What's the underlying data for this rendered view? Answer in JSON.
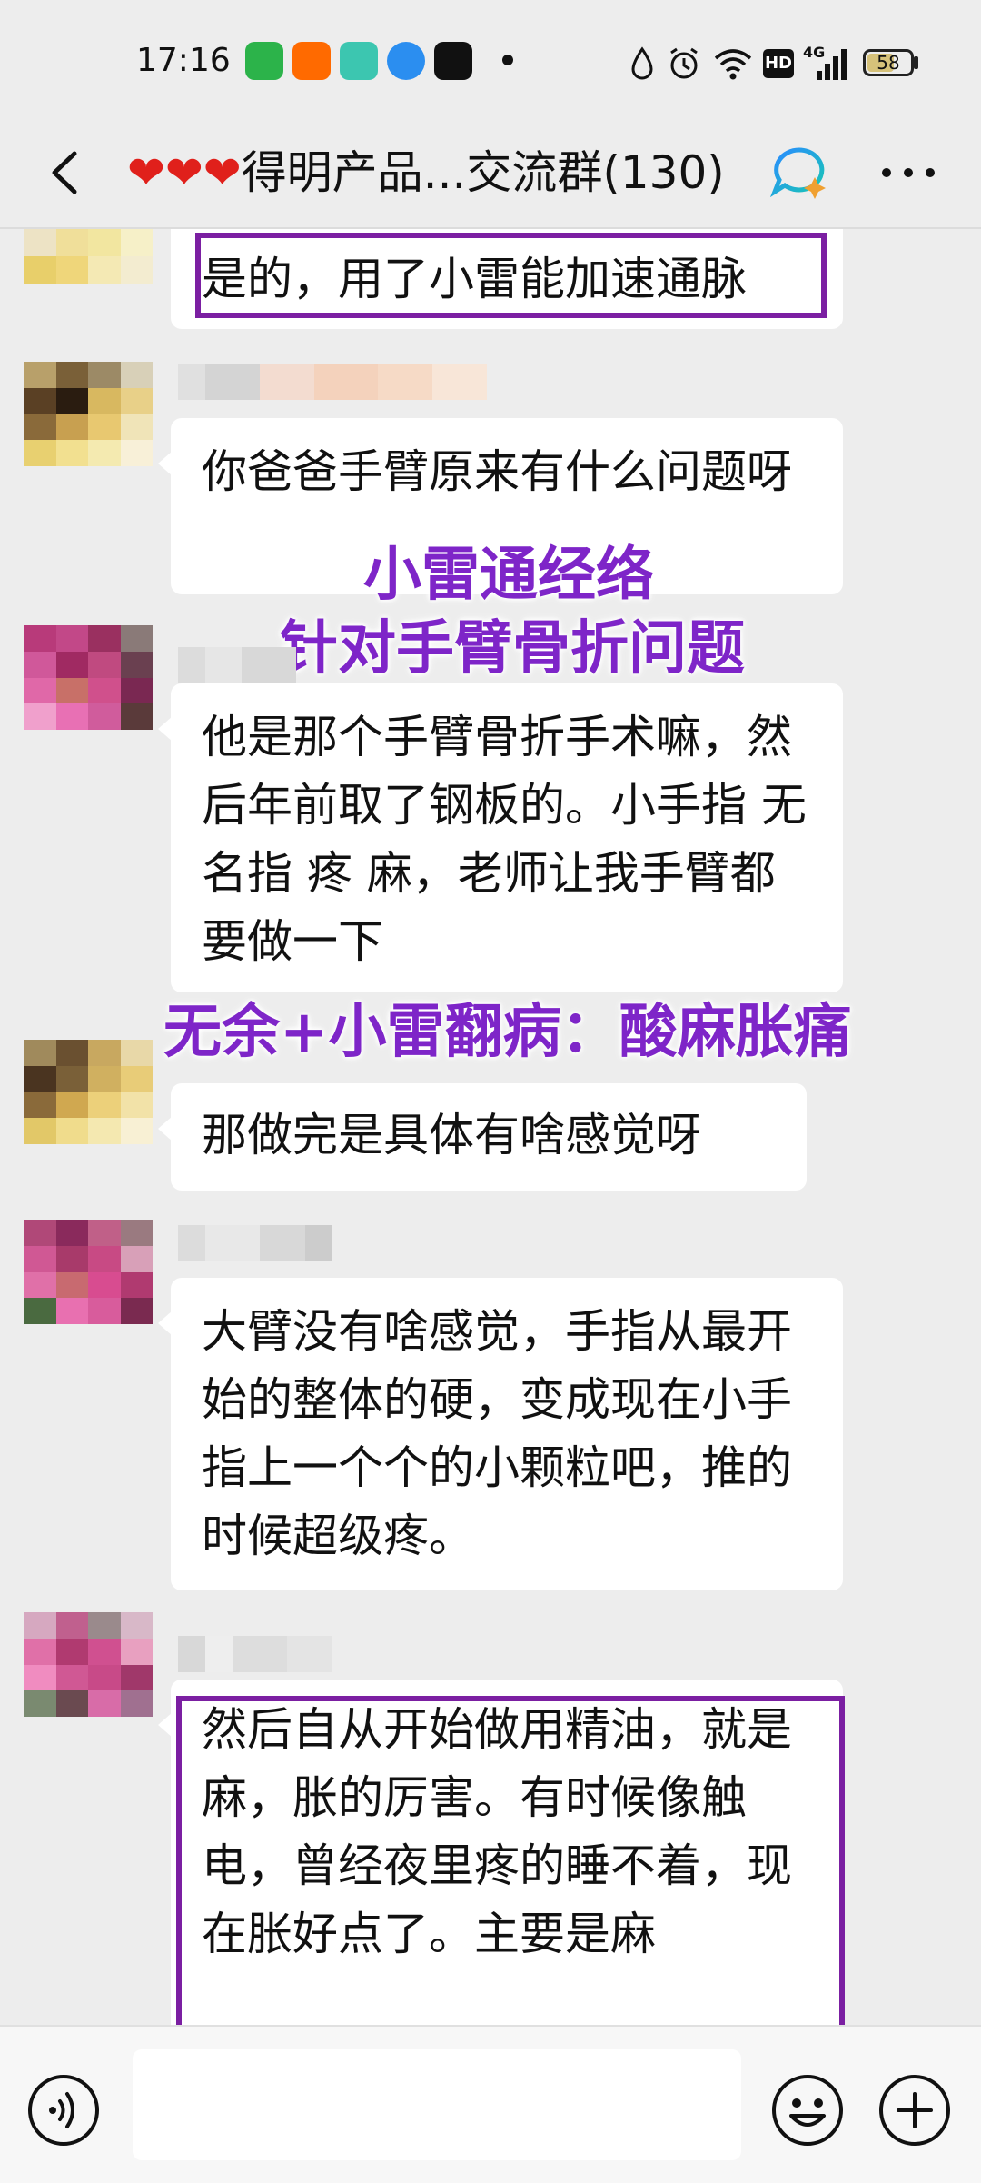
{
  "status_bar": {
    "time": "17:16",
    "network_label": "4G",
    "hd_label": "HD",
    "battery_percent": "58",
    "battery_level": 0.58
  },
  "header": {
    "hearts": "❤❤❤",
    "title": "得明产品...交流群(130)"
  },
  "messages": [
    {
      "text": "是的，用了小雷能加速通脉"
    },
    {
      "text": "你爸爸手臂原来有什么问题呀"
    },
    {
      "text": "他是那个手臂骨折手术嘛，然后年前取了钢板的。小手指 无名指 疼 麻，老师让我手臂都要做一下"
    },
    {
      "text": "那做完是具体有啥感觉呀"
    },
    {
      "text": "大臂没有啥感觉，手指从最开始的整体的硬，变成现在小手指上一个个的小颗粒吧，推的时候超级疼。"
    },
    {
      "text": "然后自从开始做用精油，就是麻，胀的厉害。有时候像触电，曾经夜里疼的睡不着，现在胀好点了。主要是麻"
    }
  ],
  "annotations": {
    "line1": "小雷通经络",
    "line2": "针对手臂骨折问题",
    "line3": "无余+小雷翻病：酸麻胀痛"
  },
  "input_bar": {
    "placeholder": ""
  },
  "colors": {
    "background": "#ededed",
    "bubble": "#ffffff",
    "highlight": "#7b1fa2",
    "annotation": "#7e25c8",
    "hearts": "#e0201b"
  }
}
